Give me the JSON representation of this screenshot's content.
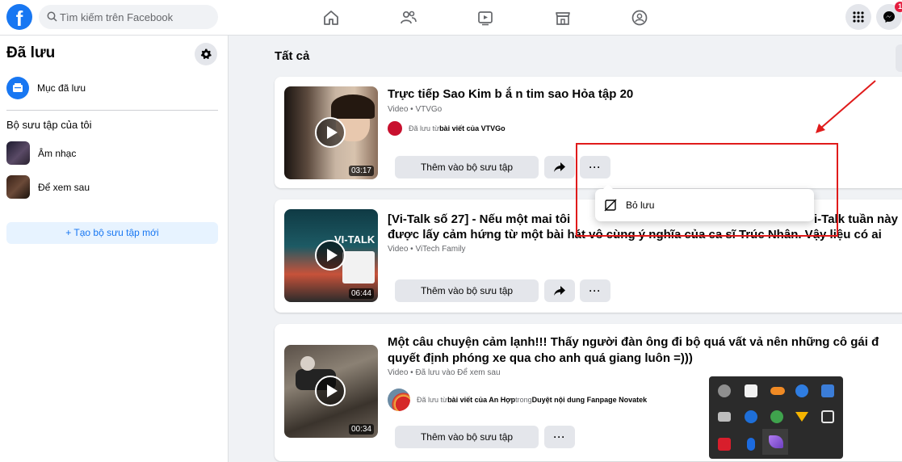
{
  "topbar": {
    "search_placeholder": "Tìm kiếm trên Facebook",
    "notification_count": "1"
  },
  "sidebar": {
    "title": "Đã lưu",
    "saved_items_label": "Mục đã lưu",
    "collections_heading": "Bộ sưu tập của tôi",
    "collections": [
      {
        "label": "Âm nhạc"
      },
      {
        "label": "Để xem sau"
      }
    ],
    "new_collection_label": "+ Tạo bộ sưu tập mới"
  },
  "main": {
    "title": "Tất cả",
    "posts": [
      {
        "title": "Trực tiếp Sao Kim b ắ n tim sao Hỏa tập 20",
        "meta": "Video • VTVGo",
        "saved_from_prefix": "Đã lưu từ ",
        "saved_from_source": "bài viết của VTVGo",
        "duration": "03:17",
        "add_to_collection": "Thêm vào bộ sưu tập",
        "more": "···"
      },
      {
        "title_line1": "[Vi-Talk số 27] - Nếu một mai tôi",
        "title_line1_right": "i-Talk tuần này",
        "title_line2": "được lấy cảm hứng từ một bài hát vô cùng ý nghĩa của ca sĩ Trúc Nhân. Vậy liệu có ai",
        "meta": "Video • ViTech Family",
        "duration": "06:44",
        "thumb_text": "VI-TALK",
        "add_to_collection": "Thêm vào bộ sưu tập",
        "more": "···"
      },
      {
        "title_line1": "Một câu chuyện cảm lạnh!!! Thấy người đàn ông đi bộ quá vất vả nên những cô gái đ",
        "title_line2": "quyết định phóng xe qua cho anh quá giang luôn =)))",
        "meta": "Video • Đã lưu vào Để xem sau",
        "saved_from_prefix": "Đã lưu từ ",
        "saved_from_source": "bài viết của An Hợp",
        "saved_from_mid": " trong ",
        "saved_from_group": "Duyệt nội dung Fanpage Novatek",
        "duration": "00:34",
        "add_to_collection": "Thêm vào bộ sưu tập",
        "more": "···"
      }
    ]
  },
  "dropdown": {
    "unsave_label": "Bỏ lưu"
  },
  "colors": {
    "brand": "#1877f2",
    "annotation": "#e01b1b",
    "background": "#f0f2f5"
  }
}
